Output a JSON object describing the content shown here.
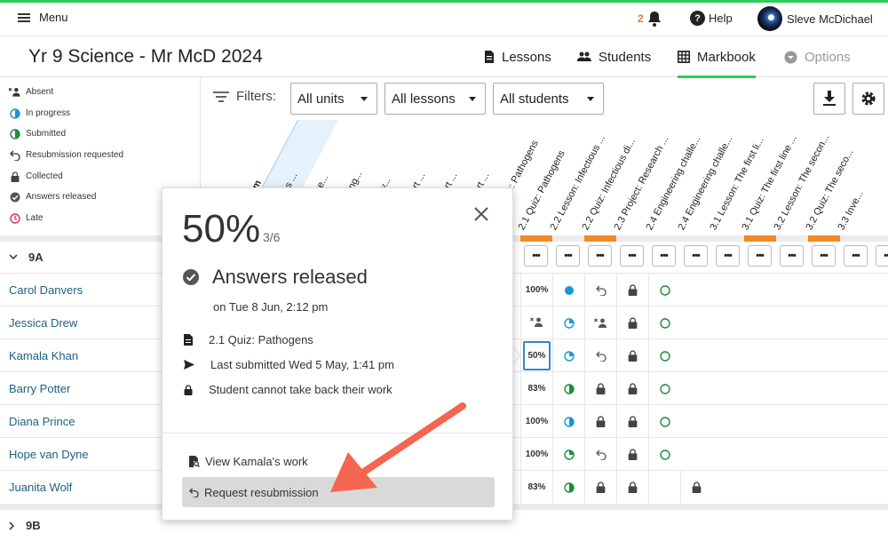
{
  "topbar": {
    "menu_label": "Menu",
    "notification_count": "2",
    "help_label": "Help",
    "user_name": "Sleve McDichael",
    "accent_color": "#2ecc59"
  },
  "header": {
    "title": "Yr 9 Science - Mr McD 2024",
    "tabs": [
      {
        "label": "Lessons",
        "icon": "document-icon"
      },
      {
        "label": "Students",
        "icon": "people-icon"
      },
      {
        "label": "Markbook",
        "icon": "grid-icon",
        "active": true
      },
      {
        "label": "Options",
        "icon": "chevron-circle-icon",
        "disabled": true
      }
    ]
  },
  "legend": [
    {
      "label": "Absent",
      "icon": "absent-icon"
    },
    {
      "label": "In progress",
      "icon": "in-progress-icon"
    },
    {
      "label": "Submitted",
      "icon": "submitted-icon"
    },
    {
      "label": "Resubmission requested",
      "icon": "undo-icon"
    },
    {
      "label": "Collected",
      "icon": "lock-icon"
    },
    {
      "label": "Answers released",
      "icon": "check-circle-icon"
    },
    {
      "label": "Late",
      "icon": "clock-icon"
    }
  ],
  "filters": {
    "label": "Filters:",
    "units": "All units",
    "lessons": "All lessons",
    "students": "All students"
  },
  "columns": [
    "une System",
    "on: Measles ...",
    "ews: The ne...",
    "ews: Slowing...",
    "you already...",
    "uilder – Part ...",
    "uilder – Part ...",
    "uilder – Part ...",
    "2.1 Lesson: Pathogens",
    "2.1 Quiz: Pathogens",
    "2.2 Lesson: Infectious ...",
    "2.2 Quiz: Infectious di...",
    "2.3 Project: Research ...",
    "2.4 Engineering challe...",
    "2.4 Engineering challe...",
    "3.1 Lesson: The first li...",
    "3.1 Quiz: The first line ...",
    "3.2 Lesson: The secon...",
    "3.2 Quiz: The seco...",
    "3.3 Inve..."
  ],
  "groups": [
    {
      "name": "9A"
    },
    {
      "name": "9B"
    }
  ],
  "students": [
    {
      "name": "Carol Danvers",
      "score": "100%"
    },
    {
      "name": "Jessica Drew",
      "score": ""
    },
    {
      "name": "Kamala Khan",
      "score": "50%"
    },
    {
      "name": "Barry Potter",
      "score": "83%"
    },
    {
      "name": "Diana Prince",
      "score": "100%"
    },
    {
      "name": "Hope van Dyne",
      "score": "100%"
    },
    {
      "name": "Juanita Wolf",
      "score": "83%"
    }
  ],
  "menu_cell_label": "•••",
  "popover": {
    "score": "50%",
    "fraction": "3/6",
    "status": "Answers released",
    "status_date": "on Tue 8 Jun, 2:12 pm",
    "quiz_name": "2.1 Quiz: Pathogens",
    "last_submitted": "Last submitted Wed 5 May, 1:41 pm",
    "take_back_note": "Student cannot take back their work",
    "view_work": "View Kamala's work",
    "request_resubmission": "Request resubmission"
  },
  "annotation_arrow_color": "#f4664f"
}
